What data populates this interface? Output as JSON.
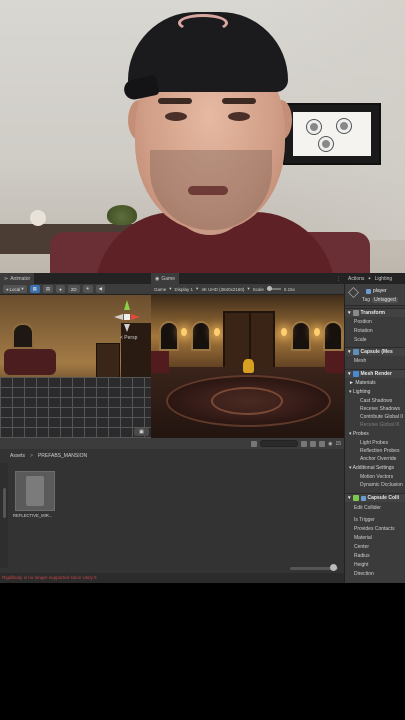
{
  "editor": {
    "tabs": [
      {
        "label": "Animator"
      },
      {
        "label": "Game"
      },
      {
        "label": "Actions"
      },
      {
        "label": "Lighting"
      }
    ],
    "scene_toolbar": {
      "pivot": "Local",
      "mode_2d": "2D"
    },
    "game_toolbar": {
      "view": "Game",
      "display": "Display 1",
      "resolution": "4K UHD (3840x2160)",
      "scale_label": "Scale",
      "scale_value": "0.15x"
    },
    "scene": {
      "persp_label": "< Persp"
    },
    "project": {
      "breadcrumb_root": "Assets",
      "breadcrumb_sep": ">",
      "breadcrumb_folder": "PREFABS_MANSION",
      "asset_label": "REFLECTIVE_MIR...",
      "count": "15",
      "status_message": "Rigidbody is no longer supported since Unity 5"
    },
    "inspector": {
      "object_name": "player",
      "tag_label": "Tag",
      "tag_value": "Untagged",
      "components": {
        "transform": "Transform",
        "capsule_mesh": "Capsule (Mes",
        "mesh_renderer": "Mesh Render",
        "capsule_collider": "Capsule Colli"
      },
      "transform_rows": [
        "Position",
        "Rotation",
        "Scale"
      ],
      "mesh_label": "Mesh",
      "materials_label": "Materials",
      "lighting_label": "Lighting",
      "lighting_rows": [
        "Cast Shadows",
        "Receive Shadows",
        "Contribute Global Il",
        "Receive Global Ill"
      ],
      "probes_label": "Probes",
      "probes_rows": [
        "Light Probes",
        "Reflection Probes",
        "Anchor Override"
      ],
      "additional_label": "Additional Settings",
      "additional_rows": [
        "Motion Vectors",
        "Dynamic Occlusion"
      ],
      "edit_collider": "Edit Collider",
      "collider_rows": [
        "Is Trigger",
        "Provides Contacts",
        "Material",
        "Center",
        "Radius",
        "Height",
        "Direction"
      ]
    }
  }
}
